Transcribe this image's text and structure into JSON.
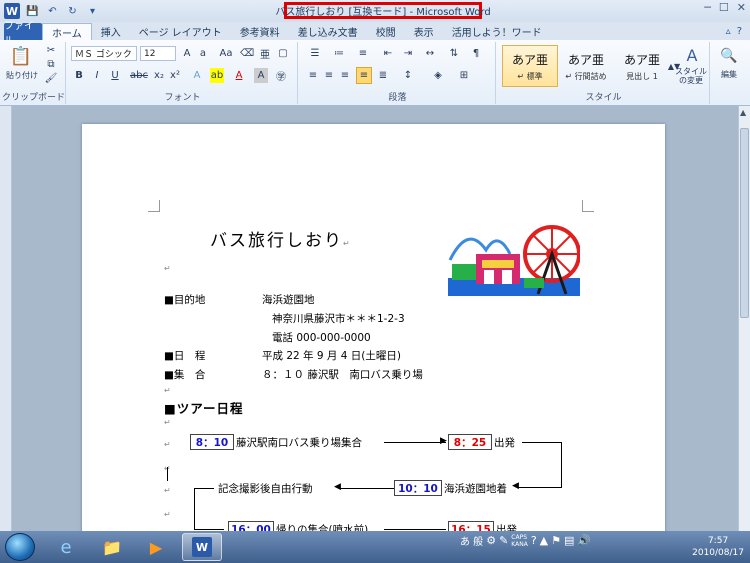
{
  "window": {
    "title": "バス旅行しおり [互換モード] - Microsoft Word"
  },
  "quick_access": {
    "logo": "W"
  },
  "menu": {
    "file_tab": "ファイル",
    "tabs": [
      "ホーム",
      "挿入",
      "ページ レイアウト",
      "参考資料",
      "差し込み文書",
      "校閲",
      "表示",
      "活用しよう！ワード"
    ]
  },
  "ribbon": {
    "clipboard": {
      "paste_label": "貼り付け",
      "group_label": "クリップボード"
    },
    "font": {
      "font_name": "ＭＳ ゴシック",
      "font_size": "12",
      "group_label": "フォント"
    },
    "paragraph": {
      "group_label": "段落"
    },
    "styles": {
      "group_label": "スタイル",
      "items": [
        {
          "sample": "あア亜",
          "name": "↵ 標準"
        },
        {
          "sample": "あア亜",
          "name": "↵ 行間詰め"
        },
        {
          "sample": "あア亜",
          "name": "見出し 1"
        }
      ],
      "change_label": "スタイルの変更"
    },
    "edit": {
      "label": "編集"
    }
  },
  "document": {
    "title": "バス旅行しおり",
    "destination_label": "■目的地",
    "destination_name": "海浜遊園地",
    "address": "神奈川県藤沢市＊＊＊1-2-3",
    "phone": "電話 000-000-0000",
    "date_label": "■日　程",
    "date_value": "平成 22 年 9 月 4 日(土曜日)",
    "meet_label": "■集　合",
    "meet_value": "８：１０ 藤沢駅　南口バス乗り場",
    "tour_heading": "■ツアー日程",
    "schedule": [
      {
        "time": "8：10",
        "text": "藤沢駅南口バス乗り場集合"
      },
      {
        "time": "8：25",
        "text": "出発"
      },
      {
        "time": "10：10",
        "text": "海浜遊園地着"
      },
      {
        "text": "記念撮影後自由行動"
      },
      {
        "time": "16：00",
        "text": "帰りの集合(噴水前)"
      },
      {
        "time": "16：15",
        "text": "出発"
      }
    ],
    "paragraph_mark": "↵"
  },
  "taskbar": {
    "ime_mode": "あ 般",
    "caps": "CAPS",
    "kana": "KANA",
    "time": "7:57",
    "date": "2010/08/17"
  }
}
